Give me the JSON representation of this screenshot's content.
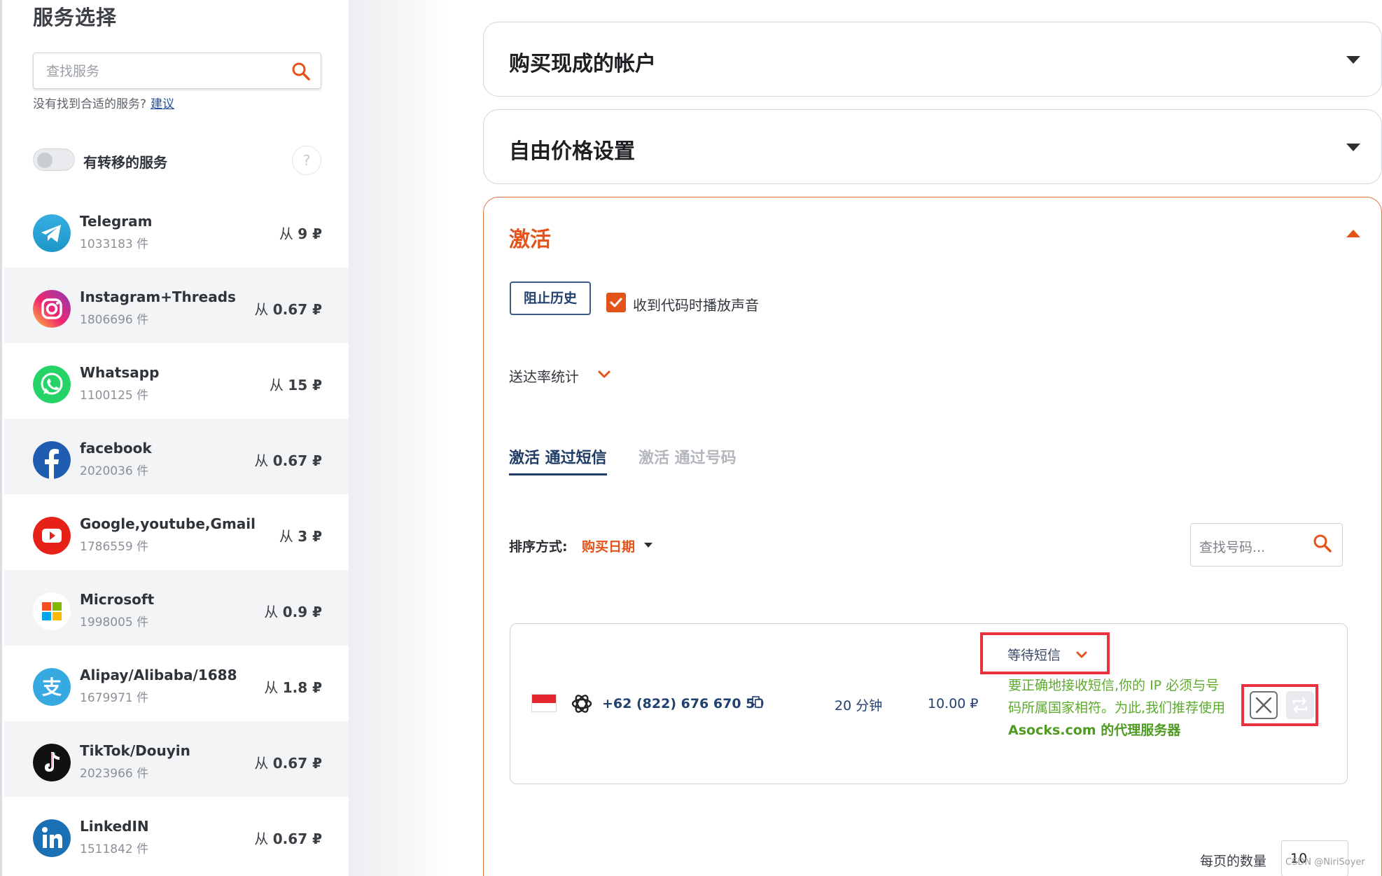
{
  "sidebar": {
    "title": "服务选择",
    "search_placeholder": "查找服务",
    "not_found_text": "没有找到合适的服务?",
    "suggest_link": "建议",
    "toggle_label": "有转移的服务",
    "help_label": "?",
    "services": [
      {
        "name": "Telegram",
        "count": "1033183 件",
        "price_prefix": "从",
        "price": "9 ₽",
        "icon": "telegram-icon"
      },
      {
        "name": "Instagram+Threads",
        "count": "1806696 件",
        "price_prefix": "从",
        "price": "0.67 ₽",
        "icon": "instagram-icon"
      },
      {
        "name": "Whatsapp",
        "count": "1100125 件",
        "price_prefix": "从",
        "price": "15 ₽",
        "icon": "whatsapp-icon"
      },
      {
        "name": "facebook",
        "count": "2020036 件",
        "price_prefix": "从",
        "price": "0.67 ₽",
        "icon": "facebook-icon"
      },
      {
        "name": "Google,youtube,Gmail",
        "count": "1786559 件",
        "price_prefix": "从",
        "price": "3 ₽",
        "icon": "youtube-icon"
      },
      {
        "name": "Microsoft",
        "count": "1998005 件",
        "price_prefix": "从",
        "price": "0.9 ₽",
        "icon": "microsoft-icon"
      },
      {
        "name": "Alipay/Alibaba/1688",
        "count": "1679971 件",
        "price_prefix": "从",
        "price": "1.8 ₽",
        "icon": "alipay-icon"
      },
      {
        "name": "TikTok/Douyin",
        "count": "2023966 件",
        "price_prefix": "从",
        "price": "0.67 ₽",
        "icon": "tiktok-icon"
      },
      {
        "name": "LinkedIN",
        "count": "1511842 件",
        "price_prefix": "从",
        "price": "0.67 ₽",
        "icon": "linkedin-icon"
      }
    ]
  },
  "main": {
    "accordion_buy": "购买现成的帐户",
    "accordion_price": "自由价格设置",
    "accordion_activation": "激活",
    "block_history": "阻止历史",
    "sound_label": "收到代码时播放声音",
    "stats_label": "送达率统计",
    "tab_sms": "激活 通过短信",
    "tab_number": "激活 通过号码",
    "sort_label": "排序方式:",
    "sort_value": "购买日期",
    "number_search_placeholder": "查找号码...",
    "activation": {
      "phone": "+62 (822) 676 670 59",
      "duration": "20 分钟",
      "price": "10.00 ₽",
      "status": "等待短信",
      "note_line1": "要正确地接收短信,你的 IP 必须与号码所属国家相符。为此,我们推荐使用",
      "note_strong": "Asocks.com 的代理服务器",
      "colors": {
        "accent": "#e4541a",
        "highlight": "#e8323e",
        "note": "#5cab2c"
      }
    },
    "per_page_label": "每页的数量",
    "per_page_value": "10"
  },
  "watermark": "CSDN @NiriSoyer"
}
